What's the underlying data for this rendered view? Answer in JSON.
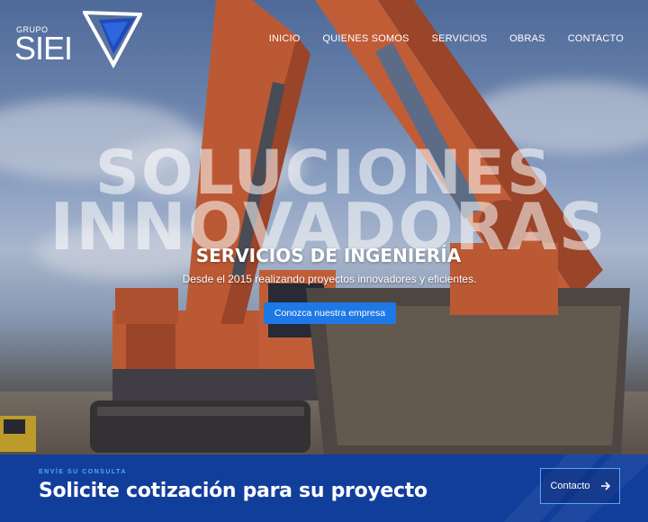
{
  "brand": {
    "small": "GRUPO",
    "name": "SIEI"
  },
  "nav": [
    "INICIO",
    "QUIENES SOMOS",
    "SERVICIOS",
    "OBRAS",
    "CONTACTO"
  ],
  "hero": {
    "big_line1": "SOLUCIONES",
    "big_line2": "INNOVADORAS",
    "subtitle": "SERVICIOS DE INGENIERÍA",
    "tagline": "Desde el 2015 realizando proyectos innovadores y eficientes.",
    "cta": "Conozca nuestra empresa"
  },
  "band": {
    "kicker": "ENVÍE SU CONSULTA",
    "title": "Solicite cotización para su proyecto",
    "button": "Contacto"
  },
  "colors": {
    "accent": "#1e78e6",
    "band": "#123e9b",
    "machine": "#e0642c"
  }
}
